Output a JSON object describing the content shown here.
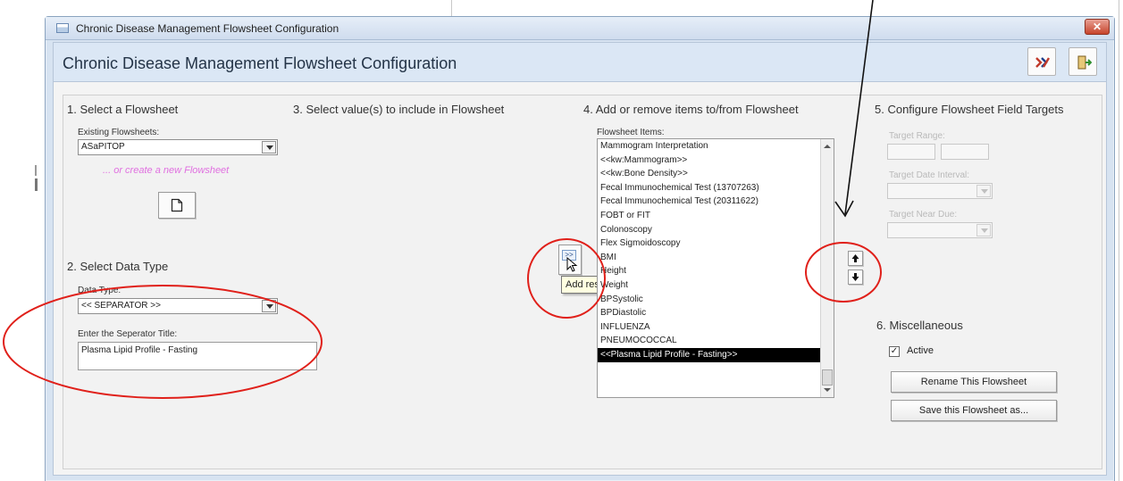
{
  "window": {
    "title": "Chronic Disease Management Flowsheet Configuration",
    "header_title": "Chronic Disease Management Flowsheet Configuration"
  },
  "header_buttons": [
    {
      "icon": "remove-flowsheet-icon"
    },
    {
      "icon": "exit-door-icon"
    }
  ],
  "section1": {
    "title": "1. Select a  Flowsheet",
    "existing_label": "Existing Flowsheets:",
    "existing_value": "ASaPITOP",
    "create_link": "... or create a new  Flowsheet",
    "new_button_icon": "new-document-icon"
  },
  "section2": {
    "title": "2. Select Data Type",
    "data_type_label": "Data Type:",
    "data_type_value": "<< SEPARATOR >>",
    "separator_label": "Enter the Seperator Title:",
    "separator_value": "Plasma Lipid Profile - Fasting"
  },
  "section3": {
    "title": "3. Select value(s) to include in Flowsheet",
    "add_button_label": ">>",
    "tooltip": "Add result to Flowsheet"
  },
  "section4": {
    "title": "4. Add or remove items to/from Flowsheet",
    "items_label": "Flowsheet Items:",
    "items": [
      "Mammogram Interpretation",
      "<<kw:Mammogram>>",
      "<<kw:Bone Density>>",
      "Fecal Immunochemical Test (13707263)",
      "Fecal Immunochemical Test (20311622)",
      "FOBT or FIT",
      "Colonoscopy",
      "Flex Sigmoidoscopy",
      "BMI",
      "Height",
      "Weight",
      "BPSystolic",
      "BPDiastolic",
      "INFLUENZA",
      "PNEUMOCOCCAL",
      "<<Plasma Lipid Profile - Fasting>>"
    ],
    "selected_index": 15,
    "move_up_icon": "arrow-up-icon",
    "move_down_icon": "arrow-down-icon"
  },
  "section5": {
    "title": "5. Configure Flowsheet Field Targets",
    "target_range_label": "Target Range:",
    "target_date_label": "Target Date Interval:",
    "target_near_due_label": "Target Near Due:"
  },
  "section6": {
    "title": "6. Miscellaneous",
    "active_label": "Active",
    "active_checked": true,
    "rename_button": "Rename This Flowsheet",
    "save_as_button": "Save this Flowsheet as..."
  },
  "annotation_color": "#e0201a"
}
